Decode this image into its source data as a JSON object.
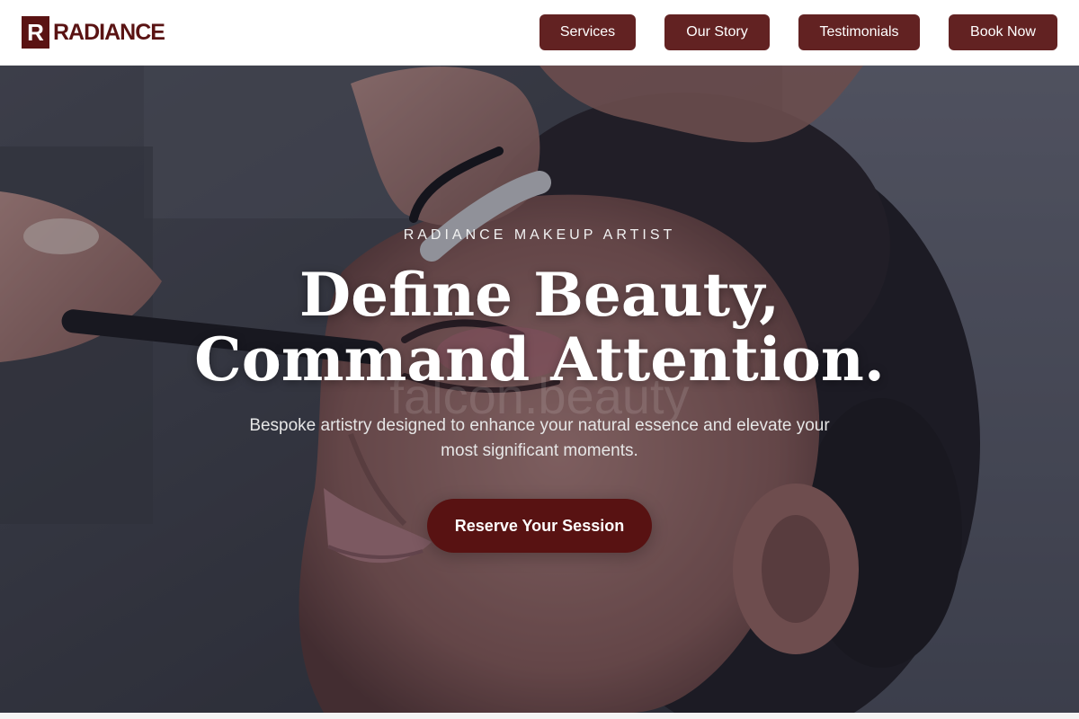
{
  "header": {
    "brand_mark": "R",
    "brand_name": "RADIANCE",
    "nav": [
      {
        "label": "Services"
      },
      {
        "label": "Our Story"
      },
      {
        "label": "Testimonials"
      },
      {
        "label": "Book Now"
      }
    ]
  },
  "hero": {
    "eyebrow": "RADIANCE MAKEUP ARTIST",
    "headline_line1": "Define Beauty,",
    "headline_line2": "Command Attention.",
    "subcopy": "Bespoke artistry designed to enhance your natural essence and elevate your most significant moments.",
    "cta_label": "Reserve Your Session",
    "watermark": "falcon.beauty"
  },
  "colors": {
    "brand": "#5a1313",
    "nav_button": "#622222",
    "cta": "#581212",
    "header_bg": "#ffffff"
  }
}
